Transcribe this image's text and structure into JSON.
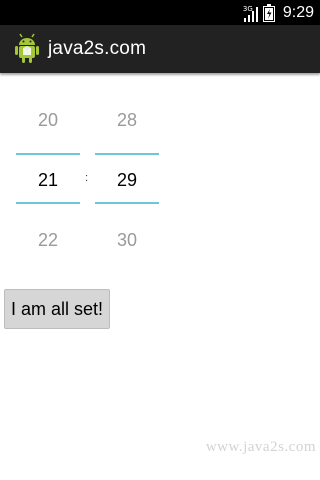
{
  "status_bar": {
    "network": "3G",
    "time": "9:29",
    "icons": [
      "signal-icon",
      "battery-icon"
    ]
  },
  "action_bar": {
    "title": "java2s.com",
    "icon": "android-icon"
  },
  "time_picker": {
    "hour": {
      "prev": "20",
      "current": "21",
      "next": "22"
    },
    "separator": ":",
    "minute": {
      "prev": "28",
      "current": "29",
      "next": "30"
    },
    "accent": "#6dc6d9"
  },
  "button": {
    "label": "I am all set!"
  },
  "watermark": "www.java2s.com"
}
